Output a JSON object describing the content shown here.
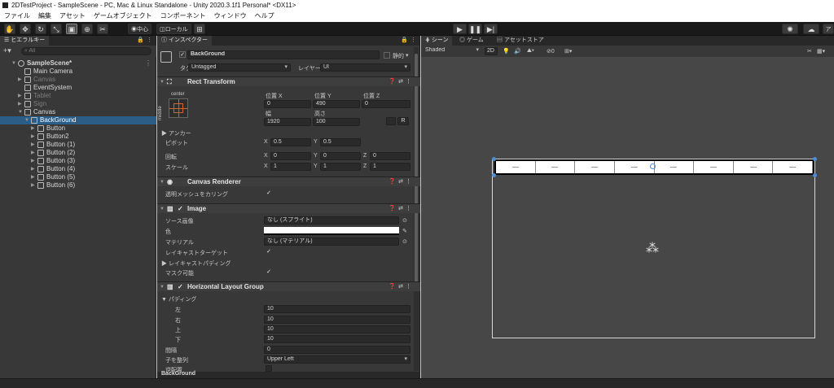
{
  "window": {
    "title": "2DTestProject - SampleScene - PC, Mac & Linux Standalone - Unity 2020.3.1f1 Personal* <DX11>"
  },
  "menu": [
    "ファイル",
    "編集",
    "アセット",
    "ゲームオブジェクト",
    "コンポーネント",
    "ウィンドウ",
    "ヘルプ"
  ],
  "toolbar": {
    "pivot_label": "中心",
    "space_label": "ローカル",
    "account_label": "ア"
  },
  "hierarchy": {
    "tab": "ヒエラルキー",
    "search_placeholder": "All",
    "items": [
      {
        "label": "SampleScene*",
        "depth": 0,
        "expanded": true,
        "dim": false,
        "selected": false,
        "bold": true,
        "icon": "unity-scene-icon"
      },
      {
        "label": "Main Camera",
        "depth": 1,
        "expanded": null,
        "dim": false,
        "selected": false,
        "icon": "gameobject-icon"
      },
      {
        "label": "Canvas",
        "depth": 1,
        "expanded": false,
        "dim": true,
        "selected": false,
        "icon": "gameobject-icon"
      },
      {
        "label": "EventSystem",
        "depth": 1,
        "expanded": null,
        "dim": false,
        "selected": false,
        "icon": "gameobject-icon"
      },
      {
        "label": "Tablet",
        "depth": 1,
        "expanded": false,
        "dim": true,
        "selected": false,
        "icon": "gameobject-icon"
      },
      {
        "label": "Sign",
        "depth": 1,
        "expanded": false,
        "dim": true,
        "selected": false,
        "icon": "gameobject-icon"
      },
      {
        "label": "Canvas",
        "depth": 1,
        "expanded": true,
        "dim": false,
        "selected": false,
        "icon": "gameobject-icon"
      },
      {
        "label": "BackGround",
        "depth": 2,
        "expanded": true,
        "dim": false,
        "selected": true,
        "icon": "gameobject-icon"
      },
      {
        "label": "Button",
        "depth": 3,
        "expanded": false,
        "dim": false,
        "selected": false,
        "icon": "gameobject-icon"
      },
      {
        "label": "Button2",
        "depth": 3,
        "expanded": false,
        "dim": false,
        "selected": false,
        "icon": "gameobject-icon"
      },
      {
        "label": "Button (1)",
        "depth": 3,
        "expanded": false,
        "dim": false,
        "selected": false,
        "icon": "gameobject-icon"
      },
      {
        "label": "Button (2)",
        "depth": 3,
        "expanded": false,
        "dim": false,
        "selected": false,
        "icon": "gameobject-icon"
      },
      {
        "label": "Button (3)",
        "depth": 3,
        "expanded": false,
        "dim": false,
        "selected": false,
        "icon": "gameobject-icon"
      },
      {
        "label": "Button (4)",
        "depth": 3,
        "expanded": false,
        "dim": false,
        "selected": false,
        "icon": "gameobject-icon"
      },
      {
        "label": "Button (5)",
        "depth": 3,
        "expanded": false,
        "dim": false,
        "selected": false,
        "icon": "gameobject-icon"
      },
      {
        "label": "Button (6)",
        "depth": 3,
        "expanded": false,
        "dim": false,
        "selected": false,
        "icon": "gameobject-icon"
      }
    ]
  },
  "inspector": {
    "tab": "インスペクター",
    "object_name": "BackGround",
    "static_label": "静的",
    "tag_label": "タグ",
    "tag_value": "Untagged",
    "layer_label": "レイヤー",
    "layer_value": "UI",
    "rect_transform": {
      "title": "Rect Transform",
      "anchor_h": "center",
      "anchor_v": "middle",
      "pos_x_label": "位置 X",
      "pos_y_label": "位置 Y",
      "pos_z_label": "位置 Z",
      "pos_x": "0",
      "pos_y": "490",
      "pos_z": "0",
      "width_label": "幅",
      "height_label": "高さ",
      "width": "1920",
      "height": "100",
      "raw_label": "R",
      "anchors_label": "アンカー",
      "pivot_label": "ピボット",
      "pivot_x": "0.5",
      "pivot_y": "0.5",
      "rotation_label": "回転",
      "rot_x": "0",
      "rot_y": "0",
      "rot_z": "0",
      "scale_label": "スケール",
      "scale_x": "1",
      "scale_y": "1",
      "scale_z": "1"
    },
    "canvas_renderer": {
      "title": "Canvas Renderer",
      "cull_label": "透明メッシュをカリング",
      "cull_checked": "✓"
    },
    "image": {
      "title": "Image",
      "source_label": "ソース画像",
      "source_value": "なし (スプライト)",
      "color_label": "色",
      "color_value": "#ffffff",
      "material_label": "マテリアル",
      "material_value": "なし (マテリアル)",
      "raycast_label": "レイキャストターゲット",
      "raycast_checked": "✓",
      "raycast_padding_label": "レイキャストパディング",
      "maskable_label": "マスク可能",
      "maskable_checked": "✓"
    },
    "hlg": {
      "title": "Horizontal Layout Group",
      "padding_label": "パディング",
      "left_label": "左",
      "left": "10",
      "right_label": "右",
      "right": "10",
      "top_label": "上",
      "top": "10",
      "bottom_label": "下",
      "bottom": "10",
      "spacing_label": "間隔",
      "spacing": "0",
      "child_align_label": "子を整列",
      "child_align": "Upper Left",
      "reverse_label": "逆配置"
    },
    "footer": "BackGround"
  },
  "scene": {
    "tabs": [
      "シーン",
      "ゲーム",
      "アセットストア"
    ],
    "shading": "Shaded",
    "mode_2d": "2D",
    "gizmo_count": "0",
    "button_count": 8
  },
  "colors": {
    "selection": "#2c5d87",
    "panel": "#383838",
    "scene_bg": "#474747"
  }
}
